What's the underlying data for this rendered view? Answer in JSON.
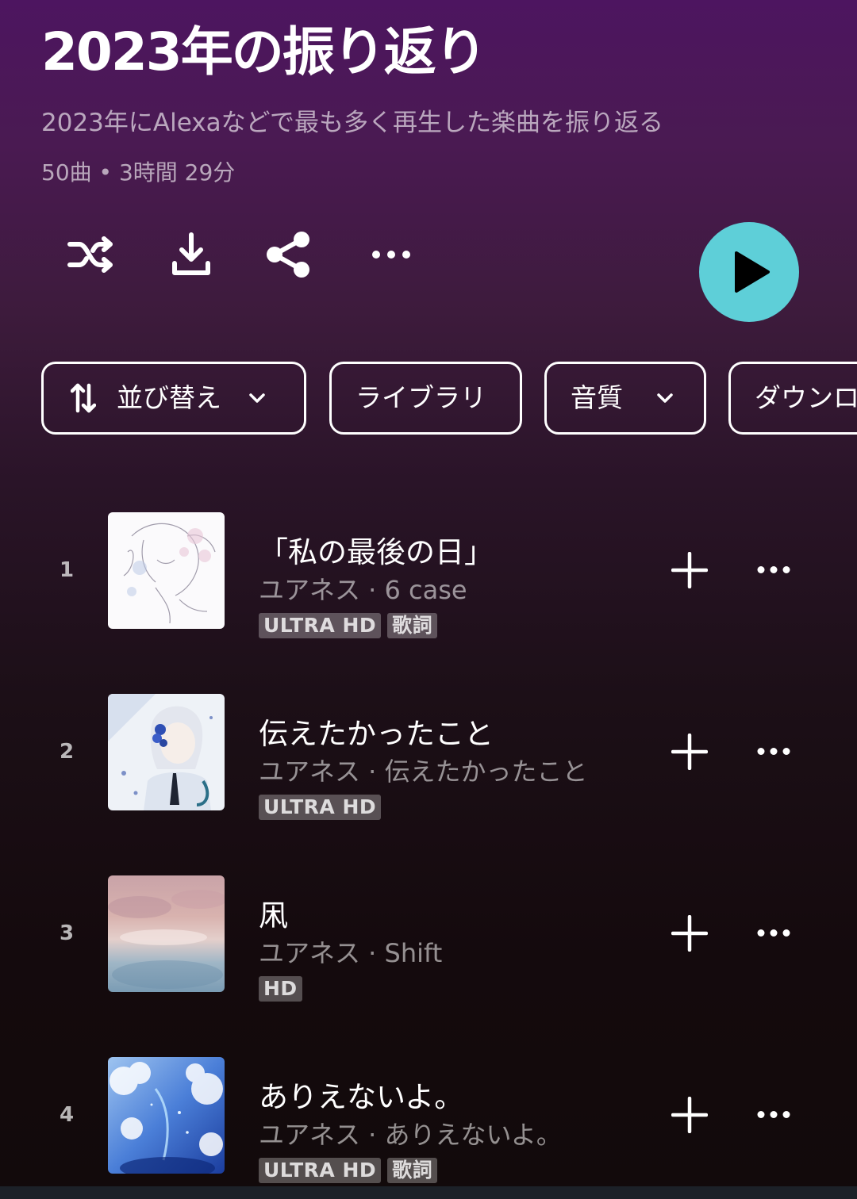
{
  "playlist": {
    "title": "2023年の振り返り",
    "subtitle": "2023年にAlexaなどで最も多く再生した楽曲を振り返る",
    "meta": "50曲 • 3時間 29分"
  },
  "actions": {
    "shuffle_icon": "shuffle-icon",
    "download_icon": "download-icon",
    "share_icon": "share-icon",
    "more_icon": "more-icon",
    "play_icon": "play-icon",
    "play_color": "#5ecfd8"
  },
  "filters": [
    {
      "label": "並び替え",
      "has_sort_icon": true,
      "has_dropdown": true
    },
    {
      "label": "ライブラリ",
      "has_sort_icon": false,
      "has_dropdown": false
    },
    {
      "label": "音質",
      "has_sort_icon": false,
      "has_dropdown": true
    },
    {
      "label": "ダウンロ",
      "has_sort_icon": false,
      "has_dropdown": false
    }
  ],
  "tracks": [
    {
      "number": "1",
      "title": "「私の最後の日」",
      "artist": "ユアネス · 6 case",
      "badges": [
        "ULTRA HD",
        "歌詞"
      ]
    },
    {
      "number": "2",
      "title": "伝えたかったこと",
      "artist": "ユアネス · 伝えたかったこと",
      "badges": [
        "ULTRA HD"
      ]
    },
    {
      "number": "3",
      "title": "凩",
      "artist": "ユアネス · Shift",
      "badges": [
        "HD"
      ]
    },
    {
      "number": "4",
      "title": "ありえないよ。",
      "artist": "ユアネス · ありえないよ。",
      "badges": [
        "ULTRA HD",
        "歌詞"
      ]
    }
  ]
}
